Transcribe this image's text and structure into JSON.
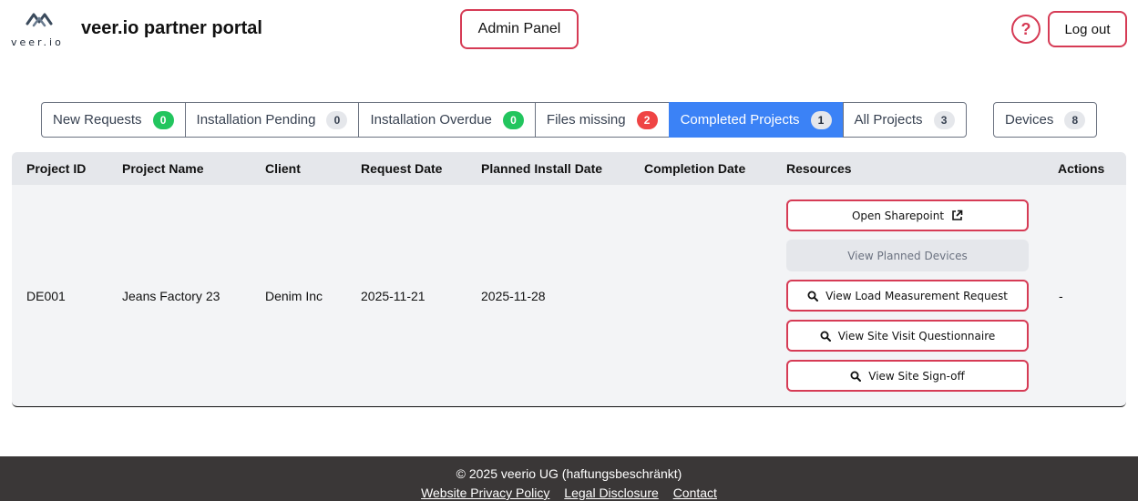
{
  "header": {
    "logo_text": "veer.io",
    "title": "veer.io partner portal",
    "admin_panel_label": "Admin Panel",
    "help_label": "?",
    "logout_label": "Log out"
  },
  "tabs": [
    {
      "label": "New Requests",
      "count": "0",
      "badge_color": "#22c55e"
    },
    {
      "label": "Installation Pending",
      "count": "0",
      "badge_color": "#e5e7eb"
    },
    {
      "label": "Installation Overdue",
      "count": "0",
      "badge_color": "#22c55e"
    },
    {
      "label": "Files missing",
      "count": "2",
      "badge_color": "#ef4444"
    },
    {
      "label": "Completed Projects",
      "count": "1",
      "badge_color": "#e5e7eb",
      "active": true
    },
    {
      "label": "All Projects",
      "count": "3",
      "badge_color": "#e5e7eb"
    }
  ],
  "devices_tab": {
    "label": "Devices",
    "count": "8"
  },
  "table": {
    "headers": [
      "Project ID",
      "Project Name",
      "Client",
      "Request Date",
      "Planned Install Date",
      "Completion Date",
      "Resources",
      "Actions"
    ],
    "rows": [
      {
        "project_id": "DE001",
        "project_name": "Jeans Factory 23",
        "client": "Denim Inc",
        "request_date": "2025-11-21",
        "planned_install_date": "2025-11-28",
        "completion_date": "",
        "actions": "-"
      }
    ],
    "resources": {
      "open_sharepoint": "Open Sharepoint",
      "view_planned_devices": "View Planned Devices",
      "view_load_measurement": "View Load Measurement Request",
      "view_site_visit": "View Site Visit Questionnaire",
      "view_site_signoff": "View Site Sign-off"
    }
  },
  "footer": {
    "copyright": "© 2025 veerio UG (haftungsbeschränkt)",
    "links": [
      "Website Privacy Policy",
      "Legal Disclosure",
      "Contact"
    ]
  },
  "colors": {
    "accent": "#d63b55",
    "active_tab": "#3b82f6",
    "footer_bg": "#3a3737"
  }
}
